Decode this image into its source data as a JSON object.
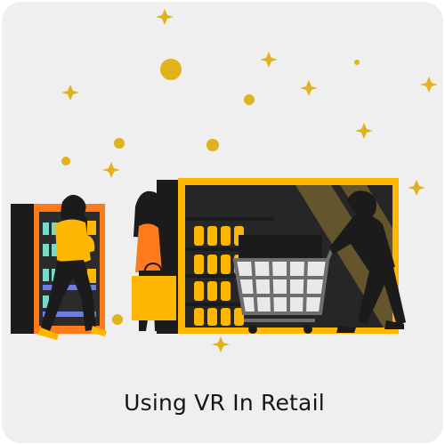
{
  "card": {
    "caption": "Using VR In Retail"
  },
  "colors": {
    "background": "#efefef",
    "accent_yellow": "#ffb600",
    "accent_orange": "#ff7a1a",
    "dark": "#1b1b1b",
    "sparkle_gold": "#e2b21c"
  },
  "illustration": {
    "icons": [
      "sparkle-icon",
      "shopping-cart-icon",
      "shopping-bag-icon",
      "vending-fridge-icon",
      "shelf-icon"
    ]
  }
}
